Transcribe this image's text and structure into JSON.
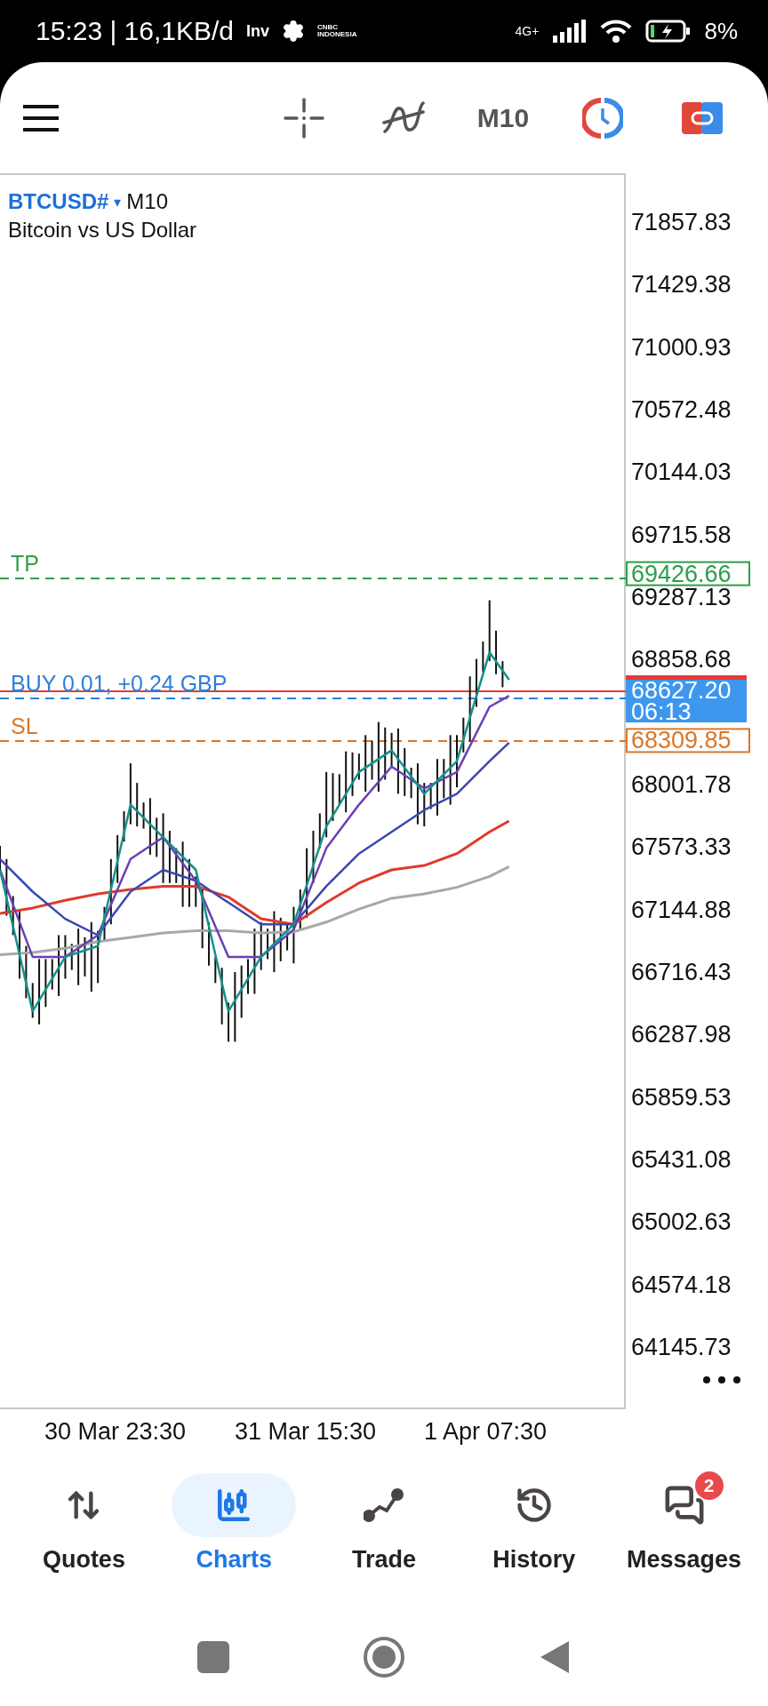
{
  "status_bar": {
    "time": "15:23 | 16,1KB/d",
    "notifications": [
      "Inv",
      "CNBC INDONESIA"
    ],
    "network": "4G+",
    "battery": "8%"
  },
  "toolbar": {
    "timeframe": "M10"
  },
  "chart": {
    "symbol": "BTCUSD#",
    "symbol_caret": "▾",
    "timeframe": "M10",
    "description": "Bitcoin vs US Dollar",
    "levels": [
      {
        "kind": "tp",
        "label": "TP",
        "tag": "69426.66",
        "color": "#2e9e4a"
      },
      {
        "kind": "order",
        "label": "BUY 0.01,  +0.24 GBP",
        "color": "#2f7fd8"
      },
      {
        "kind": "current",
        "tag": "68627.20",
        "note": "06:13",
        "color": "#e53935"
      },
      {
        "kind": "sl",
        "label": "SL",
        "tag": "68309.85",
        "color": "#d9772b"
      }
    ],
    "price_scale": [
      "71857.83",
      "71429.38",
      "71000.93",
      "70572.48",
      "70144.03",
      "69715.58",
      "69287.13",
      "68858.68",
      "68001.78",
      "67573.33",
      "67144.88",
      "66716.43",
      "66287.98",
      "65859.53",
      "65431.08",
      "65002.63",
      "64574.18",
      "64145.73"
    ],
    "time_scale": [
      "30 Mar 23:30",
      "31 Mar 15:30",
      "1 Apr 07:30"
    ]
  },
  "nav": {
    "tabs": [
      {
        "kind": "quotes",
        "label": "Quotes",
        "selected": false
      },
      {
        "kind": "charts",
        "label": "Charts",
        "selected": true
      },
      {
        "kind": "trade",
        "label": "Trade",
        "selected": false
      },
      {
        "kind": "history",
        "label": "History",
        "selected": false
      },
      {
        "kind": "messages",
        "label": "Messages",
        "selected": false,
        "badge": "2"
      }
    ]
  }
}
